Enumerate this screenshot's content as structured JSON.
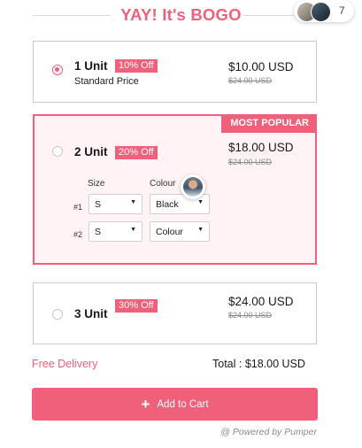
{
  "header": {
    "title": "YAY! It's BOGO",
    "viewer_count": "7"
  },
  "offers": [
    {
      "units": "1 Unit",
      "discount": "10% Off",
      "subtitle": "Standard Price",
      "price": "$10.00 USD",
      "old_price": "$24.00 USD",
      "selected": true
    },
    {
      "units": "2 Unit",
      "discount": "20% Off",
      "price": "$18.00 USD",
      "old_price": "$24.00 USD",
      "badge": "MOST POPULAR",
      "selected": false,
      "variant_headers": {
        "size": "Size",
        "colour": "Colour"
      },
      "variants": [
        {
          "label": "#1",
          "size": "S",
          "colour": "Black"
        },
        {
          "label": "#2",
          "size": "S",
          "colour": "Colour"
        }
      ]
    },
    {
      "units": "3 Unit",
      "discount": "30% Off",
      "price": "$24.00 USD",
      "old_price": "$24.00 USD",
      "selected": false
    }
  ],
  "footer": {
    "free_delivery": "Free Delivery",
    "total": "Total : $18.00 USD",
    "add_to_cart": "Add to Cart",
    "powered_by": "@ Powered by Pumper"
  },
  "colors": {
    "accent": "#f0607a",
    "highlight_bg": "#fff3f5",
    "border": "#c9c9c9"
  }
}
